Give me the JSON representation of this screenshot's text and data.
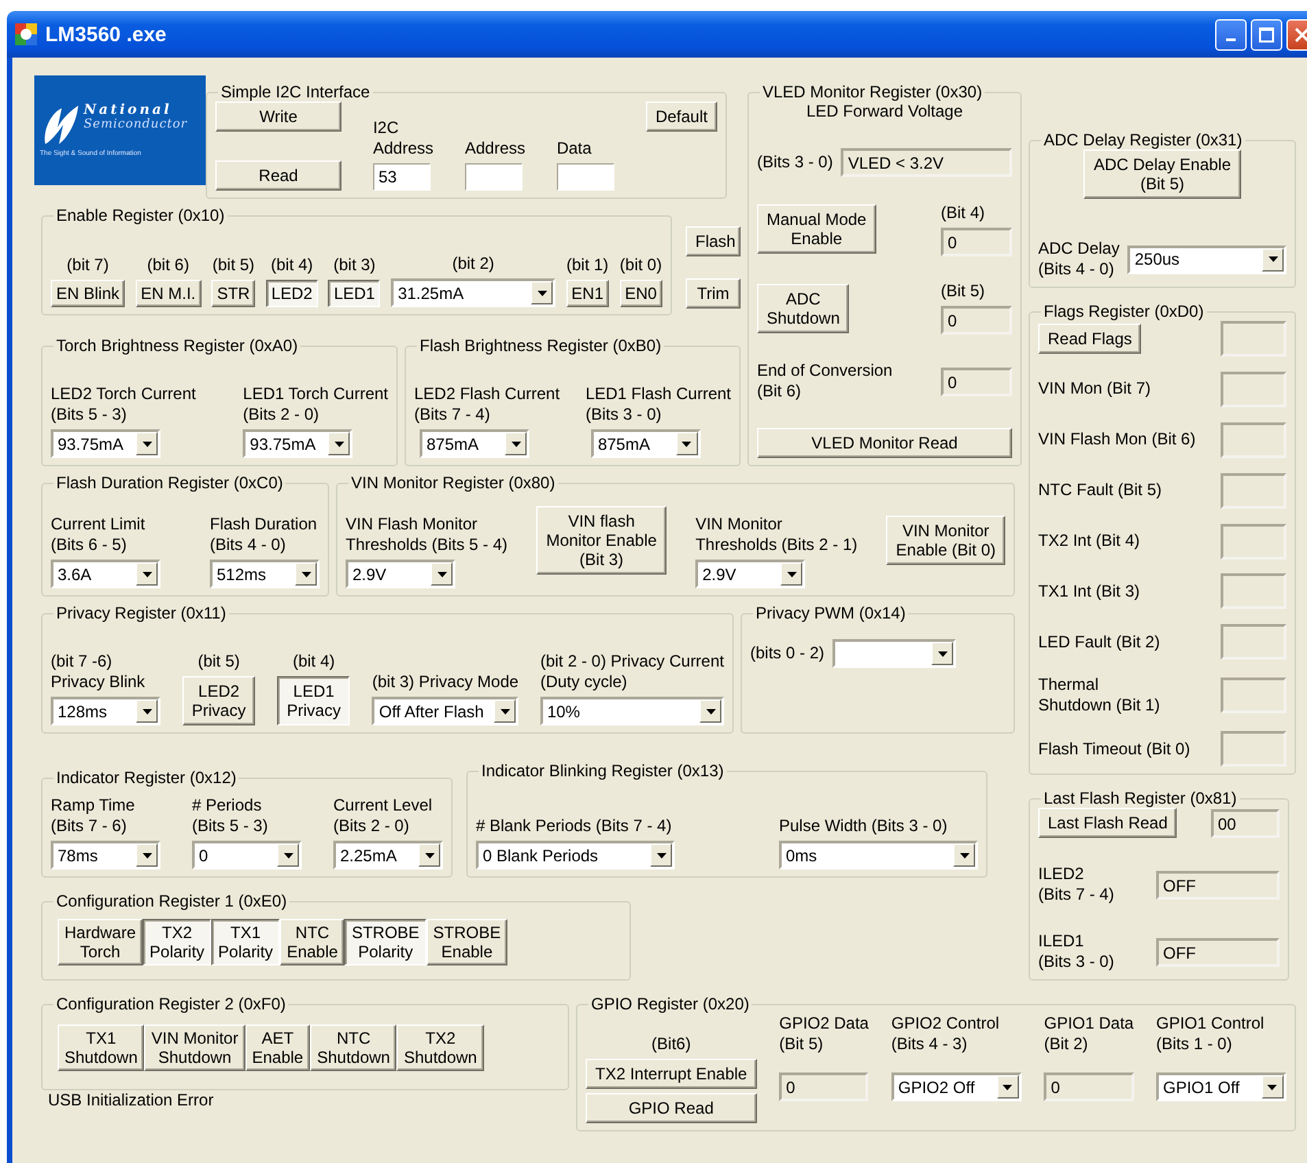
{
  "window": {
    "title": "LM3560 .exe"
  },
  "logo": {
    "name": "National",
    "subtitle": "Semiconductor",
    "tagline": "The Sight & Sound of Information"
  },
  "groups": [
    {
      "title": "Simple I2C Interface",
      "content": {
        "kind": "line",
        "items": [
          {
            "kind": "stack",
            "items": [
              {
                "kind": "button",
                "text": "Write"
              },
              {
                "kind": "button",
                "text": "Read"
              }
            ]
          },
          {
            "kind": "stack",
            "items": [
              {
                "kind": "label",
                "text": "I2C\nAddress"
              },
              {
                "kind": "field",
                "value": "53"
              }
            ]
          },
          {
            "kind": "stack",
            "items": [
              {
                "kind": "label",
                "text": "Address"
              },
              {
                "kind": "field"
              }
            ]
          },
          {
            "kind": "stack",
            "items": [
              {
                "kind": "label",
                "text": "Data"
              },
              {
                "kind": "field"
              }
            ]
          },
          {
            "kind": "stack",
            "items": [
              {
                "kind": "button",
                "text": "Default"
              }
            ]
          }
        ]
      }
    },
    {
      "title": "VLED Monitor Register (0x30)",
      "content": {
        "kind": "stack",
        "items": [
          {
            "kind": "label",
            "text": "LED Forward Voltage"
          },
          {
            "kind": "line",
            "items": [
              {
                "kind": "label",
                "text": "(Bits 3 - 0)"
              },
              {
                "kind": "readout",
                "value": "VLED < 3.2V"
              }
            ]
          },
          {
            "kind": "line",
            "items": [
              {
                "kind": "toggle",
                "text": "Manual Mode\nEnable",
                "pressed": false
              },
              {
                "kind": "stack",
                "items": [
                  {
                    "kind": "label",
                    "text": "(Bit 4)"
                  },
                  {
                    "kind": "readout",
                    "value": "0"
                  }
                ]
              }
            ]
          },
          {
            "kind": "line",
            "items": [
              {
                "kind": "toggle",
                "text": "ADC\nShutdown",
                "pressed": false
              },
              {
                "kind": "stack",
                "items": [
                  {
                    "kind": "label",
                    "text": "(Bit 5)"
                  },
                  {
                    "kind": "readout",
                    "value": "0"
                  }
                ]
              }
            ]
          },
          {
            "kind": "line",
            "items": [
              {
                "kind": "label",
                "text": "End of Conversion\n(Bit 6)"
              },
              {
                "kind": "readout",
                "value": "0"
              }
            ]
          },
          {
            "kind": "button",
            "text": "VLED Monitor Read"
          }
        ]
      }
    },
    {
      "title": "ADC Delay Register (0x31)",
      "content": {
        "kind": "stack",
        "items": [
          {
            "kind": "toggle",
            "text": "ADC Delay Enable\n(Bit 5)",
            "pressed": false
          },
          {
            "kind": "line",
            "items": [
              {
                "kind": "label",
                "text": "ADC Delay\n(Bits 4 - 0)"
              },
              {
                "kind": "dropdown",
                "value": "250us"
              }
            ]
          }
        ]
      }
    },
    {
      "title": "Enable Register (0x10)",
      "content": {
        "kind": "line",
        "items": [
          {
            "kind": "stack",
            "items": [
              {
                "kind": "label",
                "text": "(bit 7)"
              },
              {
                "kind": "toggle",
                "text": "EN Blink",
                "pressed": false
              }
            ]
          },
          {
            "kind": "stack",
            "items": [
              {
                "kind": "label",
                "text": "(bit 6)"
              },
              {
                "kind": "toggle",
                "text": "EN M.I.",
                "pressed": false
              }
            ]
          },
          {
            "kind": "stack",
            "items": [
              {
                "kind": "label",
                "text": "(bit 5)"
              },
              {
                "kind": "toggle",
                "text": "STR",
                "pressed": false
              }
            ]
          },
          {
            "kind": "stack",
            "items": [
              {
                "kind": "label",
                "text": "(bit 4)"
              },
              {
                "kind": "toggle",
                "text": "LED2",
                "pressed": true
              }
            ]
          },
          {
            "kind": "stack",
            "items": [
              {
                "kind": "label",
                "text": "(bit 3)"
              },
              {
                "kind": "toggle",
                "text": "LED1",
                "pressed": true
              }
            ]
          },
          {
            "kind": "stack",
            "items": [
              {
                "kind": "label",
                "text": "(bit 2)"
              },
              {
                "kind": "dropdown",
                "value": "31.25mA"
              }
            ]
          },
          {
            "kind": "stack",
            "items": [
              {
                "kind": "label",
                "text": "(bit 1)"
              },
              {
                "kind": "toggle",
                "text": "EN1",
                "pressed": false
              }
            ]
          },
          {
            "kind": "stack",
            "items": [
              {
                "kind": "label",
                "text": "(bit 0)"
              },
              {
                "kind": "toggle",
                "text": "EN0",
                "pressed": false
              }
            ]
          }
        ]
      }
    },
    {
      "title": "Flags Register (0xD0)",
      "content": {
        "kind": "stack",
        "items": [
          {
            "kind": "line",
            "items": [
              {
                "kind": "button",
                "text": "Read Flags"
              },
              {
                "kind": "readout"
              }
            ]
          },
          {
            "kind": "line",
            "items": [
              {
                "kind": "label",
                "text": "VIN Mon (Bit 7)"
              },
              {
                "kind": "readout"
              }
            ]
          },
          {
            "kind": "line",
            "items": [
              {
                "kind": "label",
                "text": "VIN Flash Mon (Bit 6)"
              },
              {
                "kind": "readout"
              }
            ]
          },
          {
            "kind": "line",
            "items": [
              {
                "kind": "label",
                "text": "NTC Fault (Bit 5)"
              },
              {
                "kind": "readout"
              }
            ]
          },
          {
            "kind": "line",
            "items": [
              {
                "kind": "label",
                "text": "TX2 Int (Bit 4)"
              },
              {
                "kind": "readout"
              }
            ]
          },
          {
            "kind": "line",
            "items": [
              {
                "kind": "label",
                "text": "TX1 Int (Bit 3)"
              },
              {
                "kind": "readout"
              }
            ]
          },
          {
            "kind": "line",
            "items": [
              {
                "kind": "label",
                "text": "LED Fault (Bit 2)"
              },
              {
                "kind": "readout"
              }
            ]
          },
          {
            "kind": "line",
            "items": [
              {
                "kind": "label",
                "text": "Thermal\nShutdown (Bit 1)"
              },
              {
                "kind": "readout"
              }
            ]
          },
          {
            "kind": "line",
            "items": [
              {
                "kind": "label",
                "text": "Flash Timeout (Bit 0)"
              },
              {
                "kind": "readout"
              }
            ]
          }
        ]
      }
    },
    {
      "title": "Torch Brightness Register (0xA0)",
      "content": {
        "kind": "line",
        "items": [
          {
            "kind": "stack",
            "items": [
              {
                "kind": "label",
                "text": "LED2 Torch Current\n(Bits 5 - 3)"
              },
              {
                "kind": "dropdown",
                "value": "93.75mA"
              }
            ]
          },
          {
            "kind": "stack",
            "items": [
              {
                "kind": "label",
                "text": "LED1 Torch Current\n(Bits 2 - 0)"
              },
              {
                "kind": "dropdown",
                "value": "93.75mA"
              }
            ]
          }
        ]
      }
    },
    {
      "title": "Flash Brightness Register (0xB0)",
      "content": {
        "kind": "line",
        "items": [
          {
            "kind": "stack",
            "items": [
              {
                "kind": "label",
                "text": "LED2 Flash Current\n(Bits 7 - 4)"
              },
              {
                "kind": "dropdown",
                "value": "875mA"
              }
            ]
          },
          {
            "kind": "stack",
            "items": [
              {
                "kind": "label",
                "text": "LED1 Flash Current\n(Bits 3 - 0)"
              },
              {
                "kind": "dropdown",
                "value": "875mA"
              }
            ]
          }
        ]
      }
    },
    {
      "title": "Flash Duration Register (0xC0)",
      "content": {
        "kind": "line",
        "items": [
          {
            "kind": "stack",
            "items": [
              {
                "kind": "label",
                "text": "Current Limit\n(Bits 6 - 5)"
              },
              {
                "kind": "dropdown",
                "value": "3.6A"
              }
            ]
          },
          {
            "kind": "stack",
            "items": [
              {
                "kind": "label",
                "text": "Flash Duration\n(Bits 4 - 0)"
              },
              {
                "kind": "dropdown",
                "value": "512ms"
              }
            ]
          }
        ]
      }
    },
    {
      "title": "VIN Monitor Register (0x80)",
      "content": {
        "kind": "line",
        "items": [
          {
            "kind": "stack",
            "items": [
              {
                "kind": "label",
                "text": "VIN Flash Monitor\nThresholds (Bits 5 - 4)"
              },
              {
                "kind": "dropdown",
                "value": "2.9V"
              }
            ]
          },
          {
            "kind": "toggle",
            "text": "VIN flash\nMonitor Enable\n(Bit 3)",
            "pressed": false
          },
          {
            "kind": "stack",
            "items": [
              {
                "kind": "label",
                "text": "VIN Monitor\nThresholds (Bits 2 - 1)"
              },
              {
                "kind": "dropdown",
                "value": "2.9V"
              }
            ]
          },
          {
            "kind": "toggle",
            "text": "VIN Monitor\nEnable (Bit 0)",
            "pressed": false
          }
        ]
      }
    },
    {
      "title": "Privacy Register (0x11)",
      "content": {
        "kind": "line",
        "items": [
          {
            "kind": "stack",
            "items": [
              {
                "kind": "label",
                "text": "(bit 7 -6)\nPrivacy Blink"
              },
              {
                "kind": "dropdown",
                "value": "128ms"
              }
            ]
          },
          {
            "kind": "stack",
            "items": [
              {
                "kind": "label",
                "text": "(bit 5)"
              },
              {
                "kind": "toggle",
                "text": "LED2\nPrivacy",
                "pressed": false
              }
            ]
          },
          {
            "kind": "stack",
            "items": [
              {
                "kind": "label",
                "text": "(bit 4)"
              },
              {
                "kind": "toggle",
                "text": "LED1\nPrivacy",
                "pressed": true
              }
            ]
          },
          {
            "kind": "stack",
            "items": [
              {
                "kind": "label",
                "text": "(bit 3) Privacy Mode"
              },
              {
                "kind": "dropdown",
                "value": "Off After Flash"
              }
            ]
          },
          {
            "kind": "stack",
            "items": [
              {
                "kind": "label",
                "text": "(bit 2 - 0) Privacy Current\n(Duty cycle)"
              },
              {
                "kind": "dropdown",
                "value": "10%"
              }
            ]
          }
        ]
      }
    },
    {
      "title": "Privacy PWM (0x14)",
      "content": {
        "kind": "line",
        "items": [
          {
            "kind": "label",
            "text": "(bits 0 - 2)"
          },
          {
            "kind": "dropdown"
          }
        ]
      }
    },
    {
      "title": "Indicator Register (0x12)",
      "content": {
        "kind": "line",
        "items": [
          {
            "kind": "stack",
            "items": [
              {
                "kind": "label",
                "text": "Ramp Time\n(Bits 7 - 6)"
              },
              {
                "kind": "dropdown",
                "value": "78ms"
              }
            ]
          },
          {
            "kind": "stack",
            "items": [
              {
                "kind": "label",
                "text": "# Periods\n(Bits 5 - 3)"
              },
              {
                "kind": "dropdown",
                "value": "0"
              }
            ]
          },
          {
            "kind": "stack",
            "items": [
              {
                "kind": "label",
                "text": "Current Level\n(Bits 2 - 0)"
              },
              {
                "kind": "dropdown",
                "value": "2.25mA"
              }
            ]
          }
        ]
      }
    },
    {
      "title": "Indicator Blinking Register (0x13)",
      "content": {
        "kind": "line",
        "items": [
          {
            "kind": "stack",
            "items": [
              {
                "kind": "label",
                "text": "# Blank Periods (Bits 7 - 4)"
              },
              {
                "kind": "dropdown",
                "value": "0 Blank Periods"
              }
            ]
          },
          {
            "kind": "stack",
            "items": [
              {
                "kind": "label",
                "text": "Pulse Width (Bits 3 - 0)"
              },
              {
                "kind": "dropdown",
                "value": "0ms"
              }
            ]
          }
        ]
      }
    },
    {
      "title": "Last Flash Register (0x81)",
      "content": {
        "kind": "stack",
        "items": [
          {
            "kind": "line",
            "items": [
              {
                "kind": "button",
                "text": "Last Flash Read"
              },
              {
                "kind": "readout",
                "value": "00"
              }
            ]
          },
          {
            "kind": "line",
            "items": [
              {
                "kind": "label",
                "text": "ILED2\n(Bits 7 - 4)"
              },
              {
                "kind": "readout",
                "value": "OFF"
              }
            ]
          },
          {
            "kind": "line",
            "items": [
              {
                "kind": "label",
                "text": "ILED1\n(Bits 3 - 0)"
              },
              {
                "kind": "readout",
                "value": "OFF"
              }
            ]
          }
        ]
      }
    },
    {
      "title": "Configuration Register 1 (0xE0)",
      "content": {
        "kind": "line",
        "items": [
          {
            "kind": "toggle",
            "text": "Hardware\nTorch",
            "pressed": false
          },
          {
            "kind": "toggle",
            "text": "TX2\nPolarity",
            "pressed": true
          },
          {
            "kind": "toggle",
            "text": "TX1\nPolarity",
            "pressed": true
          },
          {
            "kind": "toggle",
            "text": "NTC\nEnable",
            "pressed": false
          },
          {
            "kind": "toggle",
            "text": "STROBE\nPolarity",
            "pressed": true
          },
          {
            "kind": "toggle",
            "text": "STROBE\nEnable",
            "pressed": false
          }
        ]
      }
    },
    {
      "title": "Configuration Register 2 (0xF0)",
      "content": {
        "kind": "line",
        "items": [
          {
            "kind": "toggle",
            "text": "TX1\nShutdown",
            "pressed": false
          },
          {
            "kind": "toggle",
            "text": "VIN Monitor\nShutdown",
            "pressed": false
          },
          {
            "kind": "toggle",
            "text": "AET\nEnable",
            "pressed": false
          },
          {
            "kind": "toggle",
            "text": "NTC\nShutdown",
            "pressed": false
          },
          {
            "kind": "toggle",
            "text": "TX2\nShutdown",
            "pressed": false
          }
        ]
      }
    },
    {
      "title": "GPIO Register (0x20)",
      "content": {
        "kind": "line",
        "items": [
          {
            "kind": "stack",
            "items": [
              {
                "kind": "label",
                "text": "(Bit6)"
              },
              {
                "kind": "toggle",
                "text": "TX2 Interrupt Enable",
                "pressed": false
              },
              {
                "kind": "button",
                "text": "GPIO Read"
              }
            ]
          },
          {
            "kind": "stack",
            "items": [
              {
                "kind": "label",
                "text": "GPIO2 Data\n(Bit 5)"
              },
              {
                "kind": "readout",
                "value": "0"
              }
            ]
          },
          {
            "kind": "stack",
            "items": [
              {
                "kind": "label",
                "text": "GPIO2 Control\n(Bits 4 - 3)"
              },
              {
                "kind": "dropdown",
                "value": "GPIO2 Off"
              }
            ]
          },
          {
            "kind": "stack",
            "items": [
              {
                "kind": "label",
                "text": "GPIO1 Data\n(Bit 2)"
              },
              {
                "kind": "readout",
                "value": "0"
              }
            ]
          },
          {
            "kind": "stack",
            "items": [
              {
                "kind": "label",
                "text": "GPIO1 Control\n(Bits 1 - 0)"
              },
              {
                "kind": "dropdown",
                "value": "GPIO1 Off"
              }
            ]
          }
        ]
      }
    }
  ],
  "side_buttons": [
    {
      "kind": "button",
      "text": "Flash"
    },
    {
      "kind": "button",
      "text": "Trim"
    }
  ],
  "status_text": "USB Initialization Error"
}
